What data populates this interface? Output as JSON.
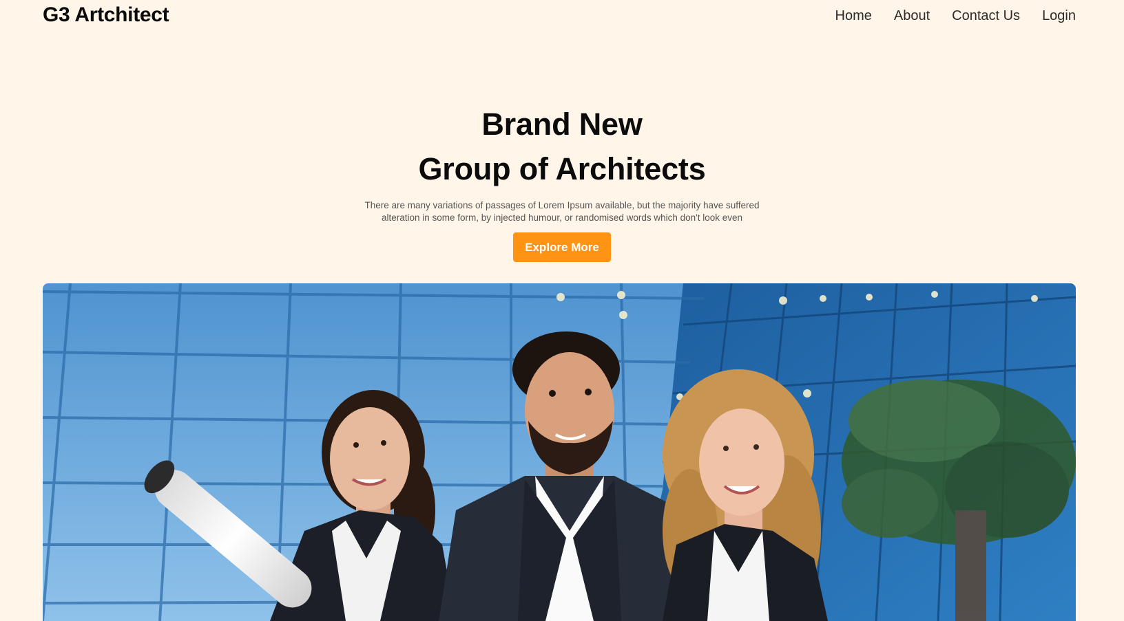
{
  "header": {
    "brand": "G3 Artchitect",
    "nav": [
      {
        "label": "Home"
      },
      {
        "label": "About"
      },
      {
        "label": "Contact Us"
      },
      {
        "label": "Login"
      }
    ]
  },
  "hero": {
    "title_line1": "Brand New",
    "title_line2": "Group of Architects",
    "subtitle_line1": "There are many variations of passages of Lorem Ipsum available, but the majority have suffered",
    "subtitle_line2": "alteration in some form, by injected humour, or randomised words which don't look even",
    "cta_label": "Explore More",
    "image_description": "Three architects in business attire standing in front of a glass building, one holding rolled blueprints"
  },
  "colors": {
    "background": "#fff5e9",
    "accent": "#ff9314",
    "text": "#0b0b0b"
  }
}
